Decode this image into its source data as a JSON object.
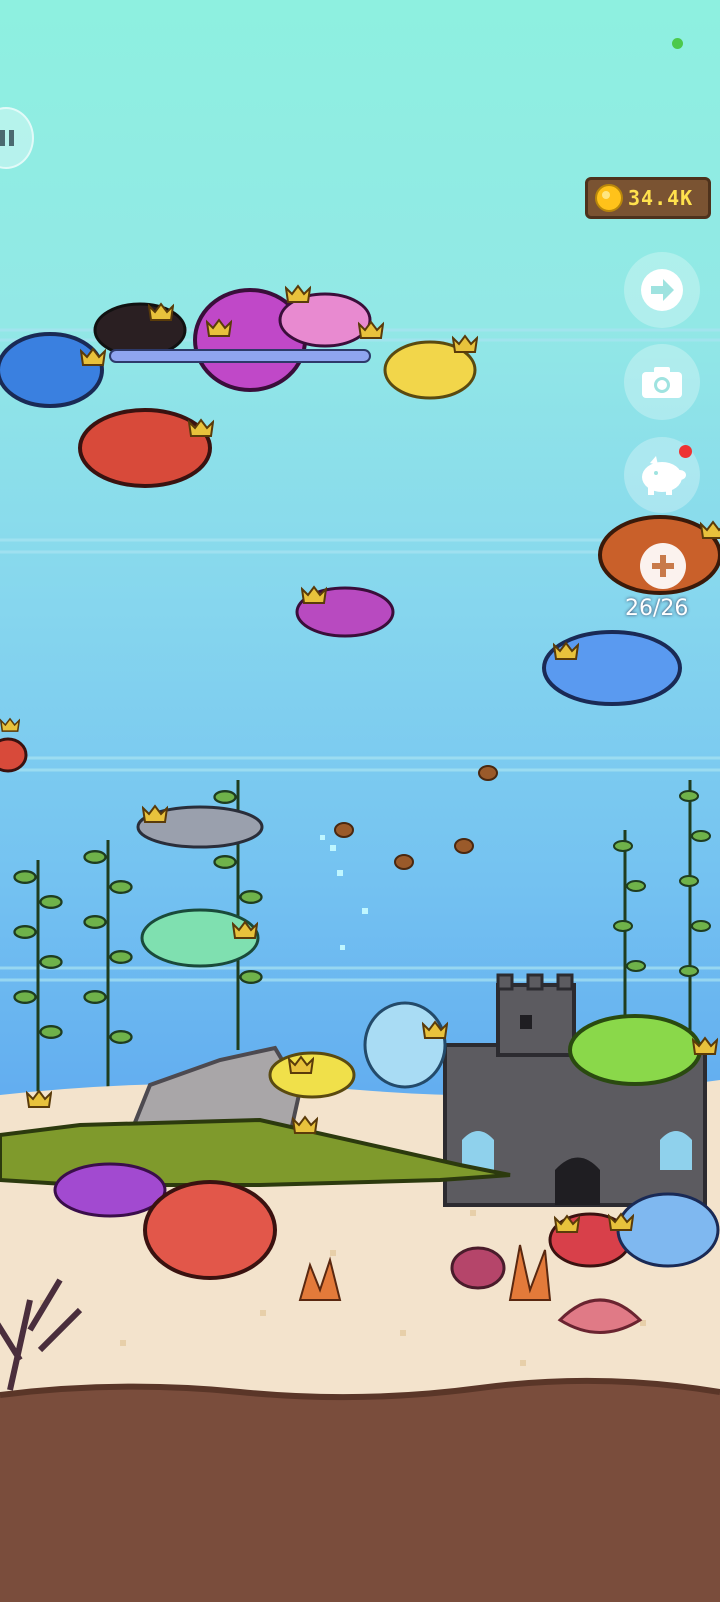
{
  "hud": {
    "coins": "34.4K",
    "capacity": "26/26"
  },
  "icons": {
    "pause": "pause-icon",
    "next": "arrow-right-icon",
    "camera": "camera-icon",
    "piggy_bank": "piggy-bank-icon",
    "add": "plus-icon",
    "coin": "coin-icon"
  },
  "colors": {
    "sky": "#8ef0e0",
    "water_mid": "#7cc7ee",
    "water_deep": "#5aa7f0",
    "sand": "#f3e3cc",
    "soil": "#7a4d3c",
    "coin_box": "#7a5332",
    "coin_text": "#ffe14d",
    "status": "#4cc94c",
    "notification": "#ee3333"
  }
}
